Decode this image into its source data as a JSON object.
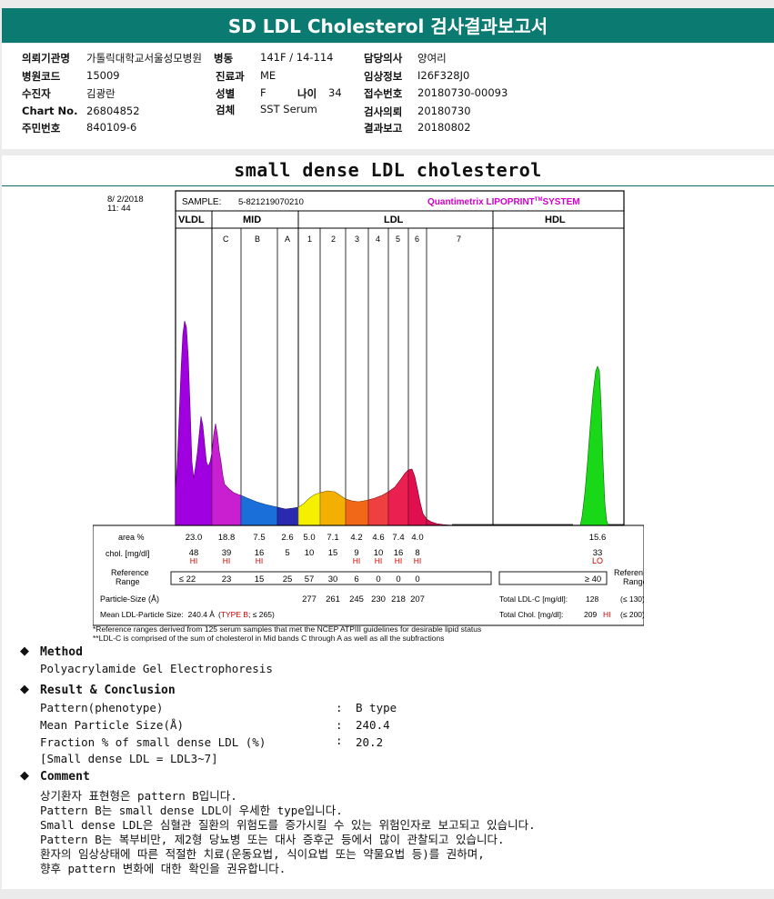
{
  "header": {
    "title": "SD LDL Cholesterol 검사결과보고서"
  },
  "info": {
    "c1": [
      {
        "label": "의뢰기관명",
        "value": "가톨릭대학교서울성모병원"
      },
      {
        "label": "병원코드",
        "value": "15009"
      },
      {
        "label": "수진자",
        "value": "김광란"
      },
      {
        "label": "Chart No.",
        "value": "26804852"
      },
      {
        "label": "주민번호",
        "value": "840109-6"
      }
    ],
    "c2": [
      {
        "label": "병동",
        "value": "141F / 14-114"
      },
      {
        "label": "진료과",
        "value": "ME"
      },
      {
        "label": "성별",
        "value": "F"
      },
      {
        "label": "검체",
        "value": "SST Serum"
      }
    ],
    "age": {
      "label": "나이",
      "value": "34"
    },
    "c3": [
      {
        "label": "담당의사",
        "value": "양여리"
      },
      {
        "label": "임상정보",
        "value": "I26F328J0"
      },
      {
        "label": "접수번호",
        "value": "20180730-00093"
      },
      {
        "label": "검사의뢰",
        "value": "20180730"
      },
      {
        "label": "결과보고",
        "value": "20180802"
      }
    ]
  },
  "report_title": "small dense LDL cholesterol",
  "gel": {
    "date": "8/ 2/2018",
    "time": "11: 44",
    "sample_label": "SAMPLE:",
    "sample_id": "5-821219070210",
    "brand": "Quantimetrix LIPOPRINT",
    "brand_tm": "TM",
    "brand_tail": "SYSTEM",
    "groups": [
      "VLDL",
      "MID",
      "LDL",
      "HDL"
    ],
    "mid_bands": [
      "C",
      "B",
      "A"
    ],
    "ldl_bands": [
      "1",
      "2",
      "3",
      "4",
      "5",
      "6",
      "7"
    ],
    "row_labels": {
      "area": "area %",
      "chol": "chol. [mg/dl]",
      "ref1": "Reference",
      "ref2": "Range",
      "ref3": "Reference",
      "ref4": "Range",
      "size": "Particle-Size (Å)"
    },
    "area": [
      "23.0",
      "18.8",
      "7.5",
      "2.6",
      "5.0",
      "7.1",
      "4.2",
      "4.6",
      "7.4",
      "4.0"
    ],
    "hdl_area": "15.6",
    "chol": [
      "48",
      "39",
      "16",
      "5",
      "10",
      "15",
      "9",
      "10",
      "16",
      "8"
    ],
    "hdl_chol": "33",
    "flags": [
      "HI",
      "HI",
      "HI",
      "",
      "",
      "",
      "HI",
      "HI",
      "HI",
      "HI"
    ],
    "hdl_flag": "LO",
    "ref": [
      "≤ 22",
      "23",
      "15",
      "25",
      "57",
      "30",
      "6",
      "0",
      "0",
      "0"
    ],
    "hdl_ref": "≥ 40",
    "sizes": [
      "277",
      "261",
      "245",
      "230",
      "218",
      "207"
    ],
    "total_ldl_label": "Total LDL-C [mg/dl]:",
    "total_ldl": "128",
    "total_ldl_ref": "(≤ 130)",
    "mean_label": "Mean LDL-Particle Size:",
    "mean_value": "240.4 Å",
    "type_open": "(",
    "type": "TYPE B",
    "type_ref": "; ≤ 265)",
    "total_chol_label": "Total Chol. [mg/dl]:",
    "total_chol": "209",
    "total_chol_flag": "HI",
    "total_chol_ref": "(≤ 200)"
  },
  "footnotes": [
    "*Reference ranges derived from 125 serum samples that met the NCEP ATPIII guidelines for desirable lipid status",
    "**LDL-C is comprised of the sum of cholesterol in Mid bands C through A as well as all the subfractions"
  ],
  "method": {
    "heading": "Method",
    "text": "Polyacrylamide Gel Electrophoresis"
  },
  "result": {
    "heading": "Result & Conclusion",
    "rows": [
      {
        "label": "Pattern(phenotype)",
        "value": "B type"
      },
      {
        "label": "Mean Particle Size(Å)",
        "value": "240.4"
      },
      {
        "label": "Fraction % of small dense LDL (%)",
        "value": "20.2"
      }
    ],
    "sep": ":",
    "note": "[Small dense LDL = LDL3~7]"
  },
  "comment": {
    "heading": "Comment",
    "lines": [
      "상기환자 표현형은 pattern B입니다.",
      "Pattern B는 small dense LDL이 우세한 type입니다.",
      "Small dense LDL은 심혈관 질환의 위험도를 증가시킬 수 있는 위험인자로 보고되고 있습니다.",
      "Pattern B는 복부비만, 제2형 당뇨병 또는 대사 증후군 등에서 많이 관찰되고 있습니다.",
      "환자의 임상상태에 따른 적절한 치료(운동요법, 식이요법 또는 약물요법 등)를 권하며,",
      "향후 pattern 변화에 대한 확인을 권유합니다."
    ]
  },
  "colors": {
    "header_bg": "#0b7b72",
    "vldl": "#a000e0",
    "mid_c": "#c81fd0",
    "mid_b": "#1a6fd8",
    "mid_a": "#2a2ab0",
    "ldl1": "#f4f000",
    "ldl2": "#f3b000",
    "ldl3": "#f06818",
    "ldl4": "#ee4040",
    "ldl5": "#ea2050",
    "ldl6": "#e01050",
    "hdl": "#18d818",
    "brand": "#d000c8",
    "flag": "#d00000"
  }
}
